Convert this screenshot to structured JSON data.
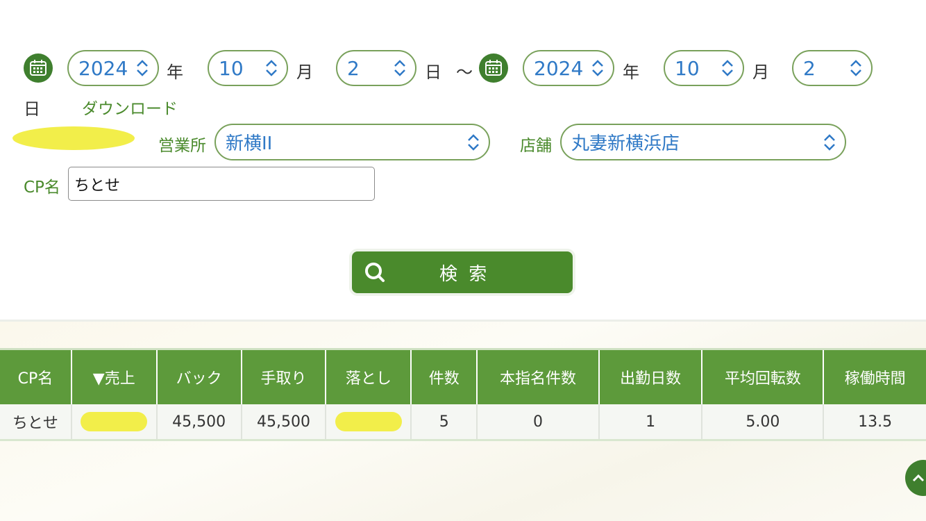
{
  "date_range": {
    "from": {
      "year": "2024",
      "month": "10",
      "day": "2"
    },
    "to": {
      "year": "2024",
      "month": "10",
      "day": "2"
    },
    "year_unit": "年",
    "month_unit": "月",
    "day_unit": "日",
    "separator": "～"
  },
  "download_label": "ダウンロード",
  "filters": {
    "office_label": "営業所",
    "office_value": "新横II",
    "shop_label": "店舗",
    "shop_value": "丸妻新横浜店",
    "cp_label": "CP名",
    "cp_value": "ちとせ"
  },
  "search_button": "検 索",
  "table": {
    "headers": [
      "CP名",
      "▼売上",
      "バック",
      "手取り",
      "落とし",
      "件数",
      "本指名件数",
      "出勤日数",
      "平均回転数",
      "稼働時間"
    ],
    "rows": [
      [
        "ちとせ",
        "",
        "45,500",
        "45,500",
        "",
        "5",
        "0",
        "1",
        "5.00",
        "13.5"
      ]
    ]
  },
  "colors": {
    "accent": "#4a8a2c",
    "header_bg": "#5d9a3b",
    "select_text": "#2f79c6",
    "redaction": "#f2ee4a"
  },
  "icons": {
    "calendar": "calendar-icon",
    "search": "search-icon",
    "chevron": "updown-chevron-icon",
    "top": "chevron-up-icon"
  }
}
